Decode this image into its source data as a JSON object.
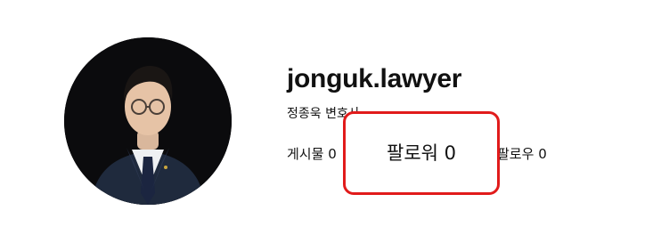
{
  "profile": {
    "username": "jonguk.lawyer",
    "display_name": "정종욱 변호사",
    "avatar_icon": "profile-photo"
  },
  "stats": {
    "posts_label": "게시물",
    "posts_count": "0",
    "followers_label": "팔로워",
    "followers_count": "0",
    "following_label": "팔로우",
    "following_count": "0"
  },
  "highlight": {
    "text": "팔로워 0",
    "border_color": "#e11b1b"
  }
}
